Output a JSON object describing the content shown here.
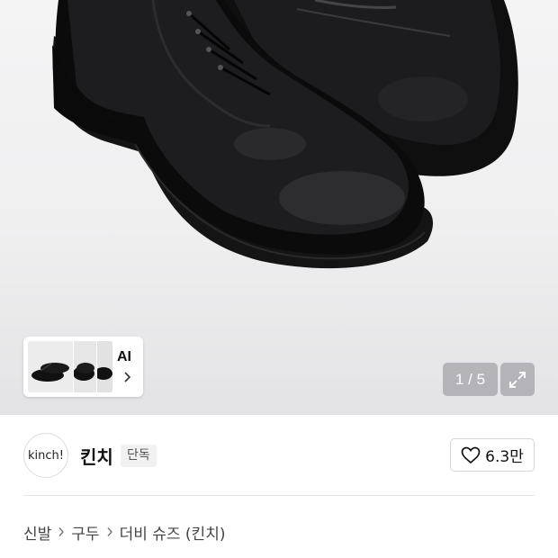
{
  "gallery": {
    "thumbnails_label": "AI",
    "counter": "1 / 5",
    "expand_icon": "expand-icon"
  },
  "brand": {
    "logo_text": "kinch!",
    "name": "킨치",
    "badge": "단독"
  },
  "like": {
    "count": "6.3만",
    "icon": "heart-icon"
  },
  "breadcrumb": {
    "items": [
      "신발",
      "구두",
      "더비 슈즈 (킨치)"
    ]
  }
}
